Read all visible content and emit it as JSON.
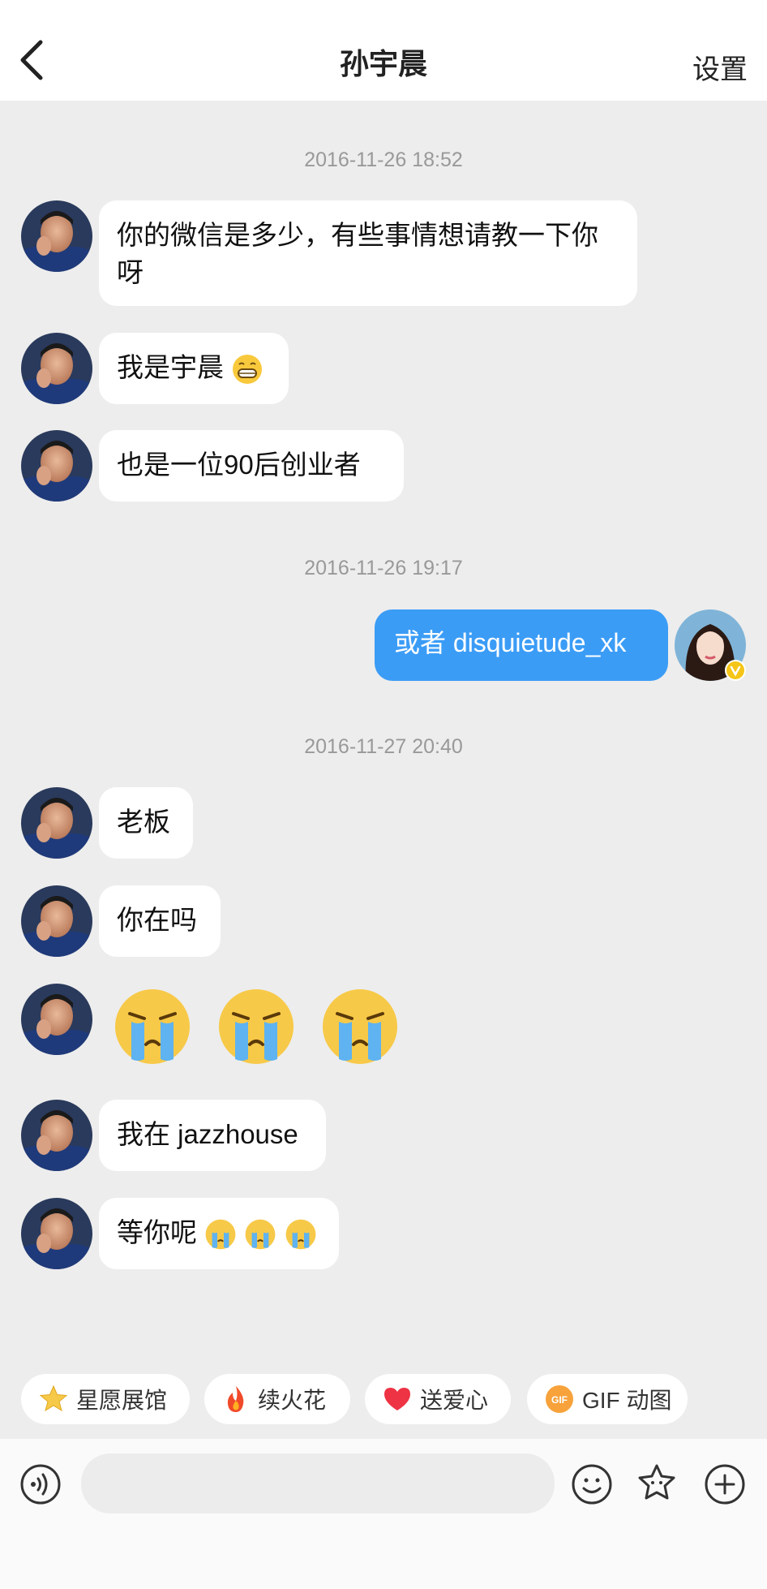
{
  "header": {
    "title": "孙宇晨",
    "settings_label": "设置"
  },
  "timestamps": [
    "2016-11-26 18:52",
    "2016-11-26 19:17",
    "2016-11-27 20:40"
  ],
  "messages": {
    "m1": "你的微信是多少，有些事情想请教一下你呀",
    "m2": "我是宇晨",
    "m3": "也是一位90后创业者",
    "m4": "或者 disquietude_xk",
    "m5": "老板",
    "m6": "你在吗",
    "m8": "我在 jazzhouse",
    "m9": "等你呢"
  },
  "quick_actions": [
    {
      "label": "星愿展馆",
      "icon": "star-icon"
    },
    {
      "label": "续火花",
      "icon": "fire-icon"
    },
    {
      "label": "送爱心",
      "icon": "heart-icon"
    },
    {
      "label": "GIF 动图",
      "icon": "gif-icon"
    }
  ],
  "input": {
    "placeholder": ""
  },
  "colors": {
    "accent": "#3b9cf6",
    "background": "#ededed",
    "badge": "#f5c518"
  }
}
